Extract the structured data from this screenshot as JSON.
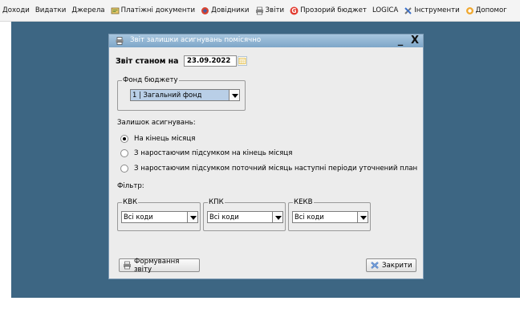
{
  "menu": [
    {
      "label": "Доходи",
      "icon": "none"
    },
    {
      "label": "Видатки",
      "icon": "none"
    },
    {
      "label": "Джерела",
      "icon": "none"
    },
    {
      "label": "Платіжні документи",
      "icon": "payment-documents-icon"
    },
    {
      "label": "Довідники",
      "icon": "directories-icon"
    },
    {
      "label": "Звіти",
      "icon": "printer-icon"
    },
    {
      "label": "Прозорий бюджет",
      "icon": "transparent-budget-icon"
    },
    {
      "label": "LOGICA",
      "icon": "none"
    },
    {
      "label": "Інструменти",
      "icon": "tools-icon"
    },
    {
      "label": "Допомог",
      "icon": "help-icon"
    }
  ],
  "dialog": {
    "title": "Звіт залишки асигнувань помісячно",
    "minimize": "_",
    "close": "X",
    "report_date_label": "Звіт станом на",
    "report_date": "23.09.2022",
    "budget_fund": {
      "legend": "Фонд бюджету",
      "selected": "1 | Загальний фонд"
    },
    "balance_label": "Залишок асигнувань:",
    "radios": [
      {
        "label": "На кінець місяця",
        "checked": true
      },
      {
        "label": "З наростаючим підсумком на кінець місяця",
        "checked": false
      },
      {
        "label": "З наростаючим підсумком поточний місяць наступні періоди уточнений план",
        "checked": false
      }
    ],
    "filter_label": "Фільтр:",
    "filters": [
      {
        "legend": "КВК",
        "value": "Всі коди"
      },
      {
        "legend": "КПК",
        "value": "Всі коди"
      },
      {
        "legend": "КЕКВ",
        "value": "Всі коди"
      }
    ],
    "generate_button": "Формування звіту",
    "close_button": "Закрити"
  },
  "colors": {
    "desktop": "#3d6683",
    "dialog_bg": "#ececec",
    "titlebar": "#8db0ce",
    "selected_combo": "#b9cfe7"
  }
}
